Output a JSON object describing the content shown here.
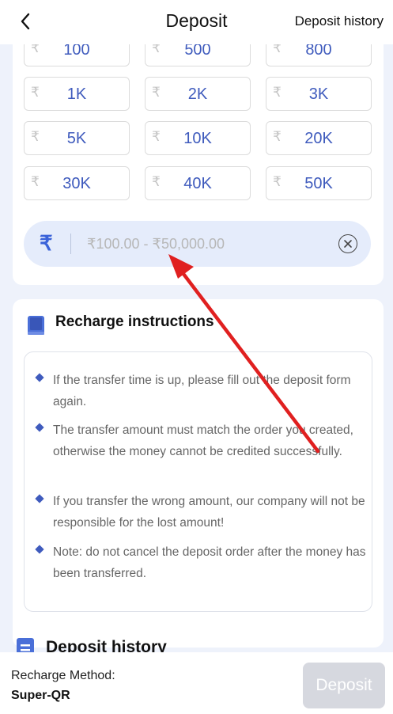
{
  "header": {
    "title": "Deposit",
    "history_link": "Deposit history"
  },
  "amounts": {
    "currency_symbol": "₹",
    "options": [
      "100",
      "500",
      "800",
      "1K",
      "2K",
      "3K",
      "5K",
      "10K",
      "20K",
      "30K",
      "40K",
      "50K"
    ]
  },
  "amount_input": {
    "placeholder": "₹100.00 - ₹50,000.00",
    "icon": "rupee-icon"
  },
  "instructions": {
    "title": "Recharge instructions",
    "items": [
      "If the transfer time is up, please fill out the deposit form again.",
      "The transfer amount must match the order you created, otherwise the money cannot be credited successfully.",
      "If you transfer the wrong amount, our company will not be responsible for the lost amount!",
      "Note: do not cancel the deposit order after the money has been transferred."
    ]
  },
  "history": {
    "title": "Deposit history"
  },
  "footer": {
    "method_label": "Recharge Method:",
    "method_value": "Super-QR",
    "deposit_label": "Deposit"
  },
  "colors": {
    "accent": "#3f5bbd",
    "page_bg": "#eef2fb",
    "input_bg": "#e5ecfb",
    "annotation_arrow": "#e02020",
    "deposit_button_disabled": "#d6d8df"
  }
}
